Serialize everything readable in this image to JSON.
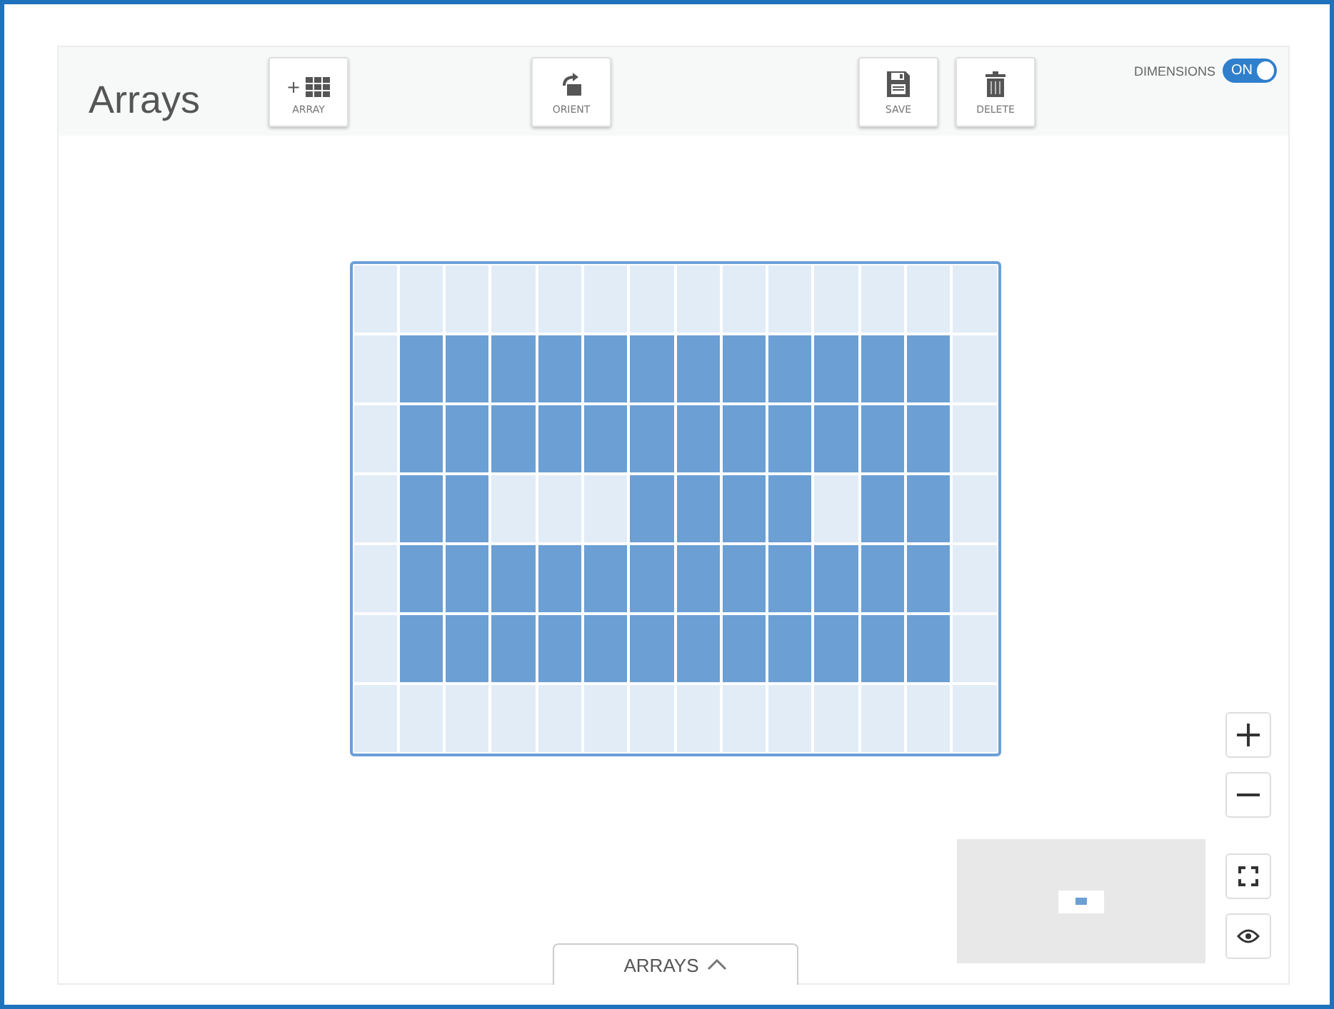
{
  "header": {
    "title": "Arrays",
    "buttons": [
      {
        "kind": "array",
        "label": "ARRAY",
        "icon_text": "+"
      },
      {
        "kind": "orient",
        "label": "ORIENT"
      },
      {
        "kind": "save",
        "label": "SAVE"
      },
      {
        "kind": "delete",
        "label": "DELETE"
      }
    ],
    "dimensions": {
      "label": "DIMENSIONS",
      "state_text": "ON",
      "on": true
    }
  },
  "grid": {
    "rows": [
      [
        {
          "filled": false
        },
        {
          "filled": false
        },
        {
          "filled": false
        },
        {
          "filled": false
        },
        {
          "filled": false
        },
        {
          "filled": false
        },
        {
          "filled": false
        },
        {
          "filled": false
        },
        {
          "filled": false
        },
        {
          "filled": false
        },
        {
          "filled": false
        },
        {
          "filled": false
        },
        {
          "filled": false
        },
        {
          "filled": false
        }
      ],
      [
        {
          "filled": false
        },
        {
          "filled": true
        },
        {
          "filled": true
        },
        {
          "filled": true
        },
        {
          "filled": true
        },
        {
          "filled": true
        },
        {
          "filled": true
        },
        {
          "filled": true
        },
        {
          "filled": true
        },
        {
          "filled": true
        },
        {
          "filled": true
        },
        {
          "filled": true
        },
        {
          "filled": true
        },
        {
          "filled": false
        }
      ],
      [
        {
          "filled": false
        },
        {
          "filled": true
        },
        {
          "filled": true
        },
        {
          "filled": true
        },
        {
          "filled": true
        },
        {
          "filled": true
        },
        {
          "filled": true
        },
        {
          "filled": true
        },
        {
          "filled": true
        },
        {
          "filled": true
        },
        {
          "filled": true
        },
        {
          "filled": true
        },
        {
          "filled": true
        },
        {
          "filled": false
        }
      ],
      [
        {
          "filled": false
        },
        {
          "filled": true
        },
        {
          "filled": true
        },
        {
          "filled": false
        },
        {
          "filled": false
        },
        {
          "filled": false
        },
        {
          "filled": true
        },
        {
          "filled": true
        },
        {
          "filled": true
        },
        {
          "filled": true
        },
        {
          "filled": false
        },
        {
          "filled": true
        },
        {
          "filled": true
        },
        {
          "filled": false
        }
      ],
      [
        {
          "filled": false
        },
        {
          "filled": true
        },
        {
          "filled": true
        },
        {
          "filled": true
        },
        {
          "filled": true
        },
        {
          "filled": true
        },
        {
          "filled": true
        },
        {
          "filled": true
        },
        {
          "filled": true
        },
        {
          "filled": true
        },
        {
          "filled": true
        },
        {
          "filled": true
        },
        {
          "filled": true
        },
        {
          "filled": false
        }
      ],
      [
        {
          "filled": false
        },
        {
          "filled": true
        },
        {
          "filled": true
        },
        {
          "filled": true
        },
        {
          "filled": true
        },
        {
          "filled": true
        },
        {
          "filled": true
        },
        {
          "filled": true
        },
        {
          "filled": true
        },
        {
          "filled": true
        },
        {
          "filled": true
        },
        {
          "filled": true
        },
        {
          "filled": true
        },
        {
          "filled": false
        }
      ],
      [
        {
          "filled": false
        },
        {
          "filled": false
        },
        {
          "filled": false
        },
        {
          "filled": false
        },
        {
          "filled": false
        },
        {
          "filled": false
        },
        {
          "filled": false
        },
        {
          "filled": false
        },
        {
          "filled": false
        },
        {
          "filled": false
        },
        {
          "filled": false
        },
        {
          "filled": false
        },
        {
          "filled": false
        },
        {
          "filled": false
        }
      ]
    ]
  },
  "zoom_controls": [
    {
      "kind": "zoom-in"
    },
    {
      "kind": "zoom-out"
    },
    {
      "kind": "fit"
    },
    {
      "kind": "view"
    }
  ],
  "bottom_tab": {
    "label": "ARRAYS",
    "expanded": false
  }
}
